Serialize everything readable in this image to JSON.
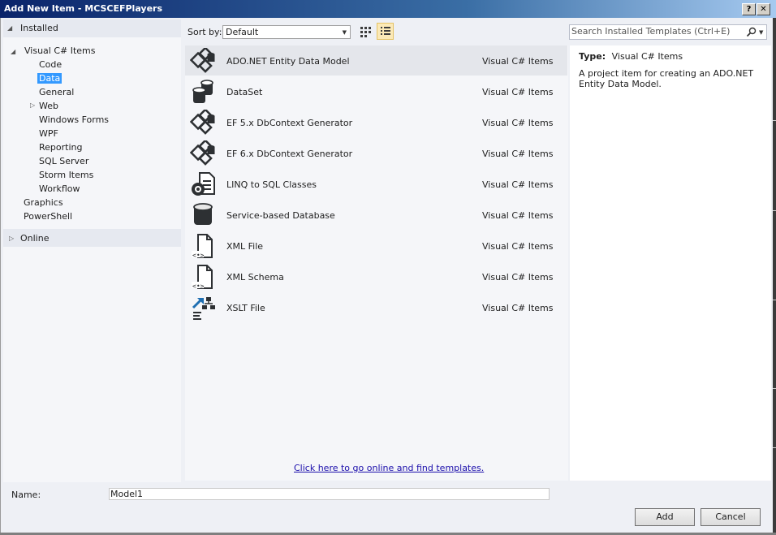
{
  "window": {
    "title": "Add New Item - MCSCEFPlayers",
    "help_glyph": "?",
    "close_glyph": "✕"
  },
  "tree": {
    "installed": "Installed",
    "visual_csharp_items": "Visual C# Items",
    "children": [
      "Code",
      "Data",
      "General",
      "Web",
      "Windows Forms",
      "WPF",
      "Reporting",
      "SQL Server",
      "Storm Items",
      "Workflow"
    ],
    "selected": "Data",
    "graphics": "Graphics",
    "powershell": "PowerShell",
    "online": "Online"
  },
  "toolbar": {
    "sort_label": "Sort by:",
    "sort_value": "Default",
    "search_placeholder": "Search Installed Templates (Ctrl+E)"
  },
  "templates": [
    {
      "name": "ADO.NET Entity Data Model",
      "type": "Visual C# Items",
      "icon": "entity-model-icon",
      "selected": true
    },
    {
      "name": "DataSet",
      "type": "Visual C# Items",
      "icon": "dataset-icon"
    },
    {
      "name": "EF 5.x DbContext Generator",
      "type": "Visual C# Items",
      "icon": "entity-model-icon"
    },
    {
      "name": "EF 6.x DbContext Generator",
      "type": "Visual C# Items",
      "icon": "entity-model-icon"
    },
    {
      "name": "LINQ to SQL Classes",
      "type": "Visual C# Items",
      "icon": "linq-classes-icon"
    },
    {
      "name": "Service-based Database",
      "type": "Visual C# Items",
      "icon": "database-icon"
    },
    {
      "name": "XML File",
      "type": "Visual C# Items",
      "icon": "xml-file-icon"
    },
    {
      "name": "XML Schema",
      "type": "Visual C# Items",
      "icon": "xml-file-icon"
    },
    {
      "name": "XSLT File",
      "type": "Visual C# Items",
      "icon": "xslt-file-icon"
    }
  ],
  "online_link": "Click here to go online and find templates.",
  "details": {
    "type_key": "Type:",
    "type_value": "Visual C# Items",
    "description": "A project item for creating an ADO.NET Entity Data Model."
  },
  "name_field": {
    "label": "Name:",
    "value": "Model1"
  },
  "buttons": {
    "add": "Add",
    "cancel": "Cancel"
  },
  "colors": {
    "selection": "#3399ff",
    "link": "#1a0dab",
    "icon_dark": "#2d3033"
  }
}
